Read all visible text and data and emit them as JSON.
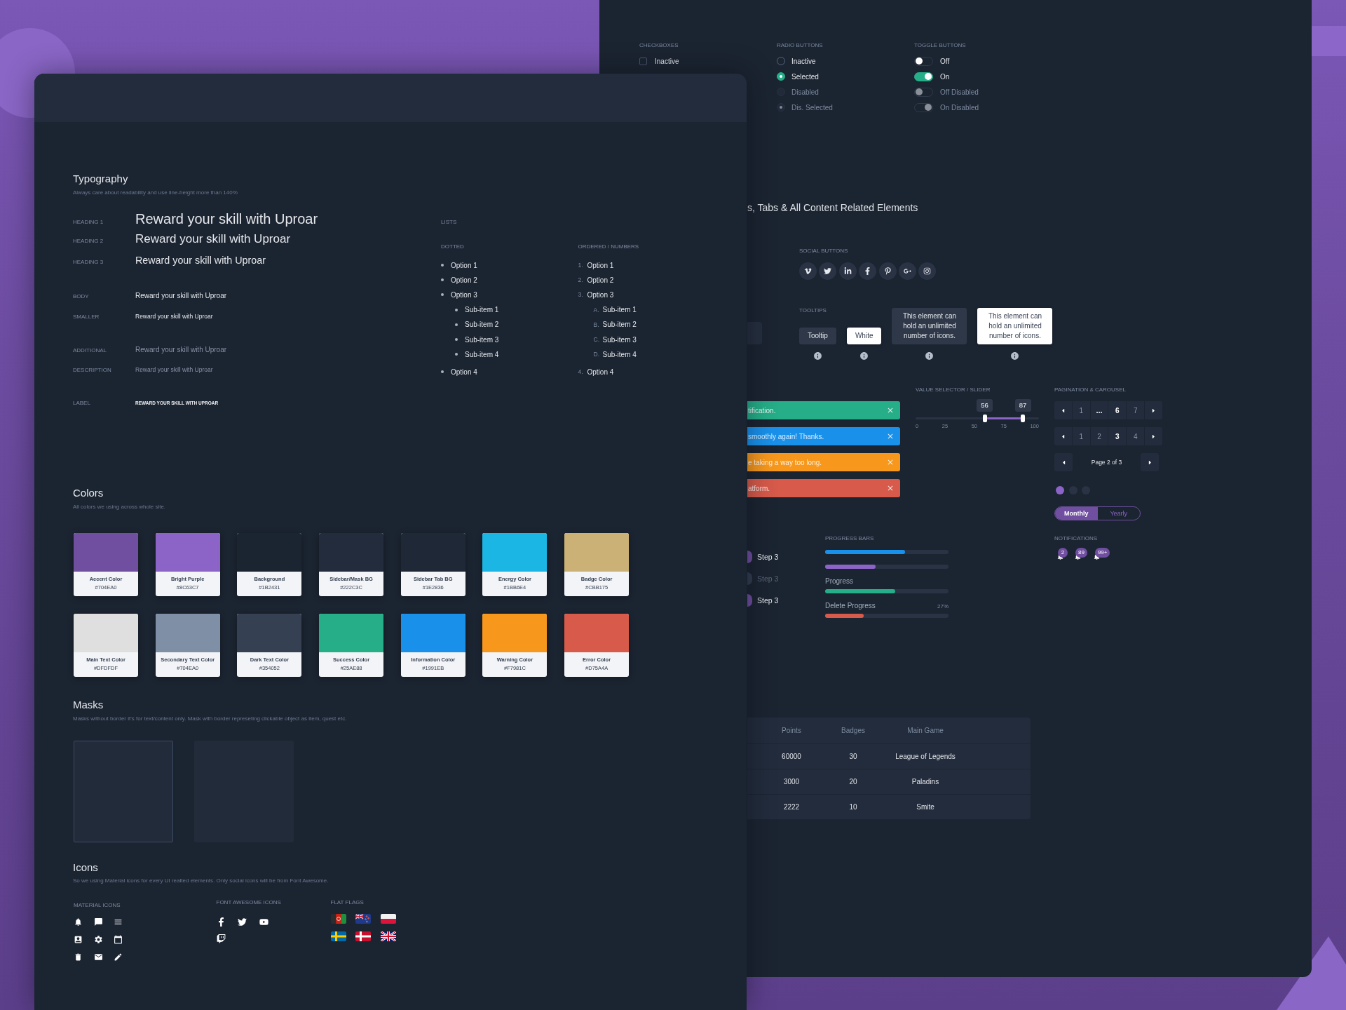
{
  "back_panel": {
    "checkboxes": {
      "label": "CHECKBOXES",
      "items": [
        {
          "label": "Inactive",
          "checked": false
        }
      ]
    },
    "radio_buttons": {
      "label": "RADIO BUTTONS",
      "items": [
        {
          "label": "Inactive",
          "selected": false,
          "disabled": false
        },
        {
          "label": "Selected",
          "selected": true,
          "disabled": false
        },
        {
          "label": "Disabled",
          "selected": false,
          "disabled": true
        },
        {
          "label": "Dis. Selected",
          "selected": true,
          "disabled": true
        }
      ]
    },
    "toggle_buttons": {
      "label": "TOGGLE BUTTONS",
      "items": [
        {
          "label": "Off",
          "on": false,
          "disabled": false
        },
        {
          "label": "On",
          "on": true,
          "disabled": false
        },
        {
          "label": "Off Disabled",
          "on": false,
          "disabled": true
        },
        {
          "label": "On Disabled",
          "on": true,
          "disabled": true
        }
      ]
    },
    "section_title": "s, Tabs & All Content Related Elements",
    "social_buttons": {
      "label": "SOCIAL BUTTONS"
    },
    "tooltips": {
      "label": "TOOLTIPS",
      "items": [
        {
          "kind": "dark",
          "text": "Tooltip"
        },
        {
          "kind": "white",
          "text": "White"
        },
        {
          "kind": "dark",
          "text": "This element can hold an unlimited number of icons."
        },
        {
          "kind": "white",
          "text": "This element can hold an unlimited number of icons."
        }
      ]
    },
    "alerts": [
      {
        "text": "tification.",
        "color": "#25ae88"
      },
      {
        "text": "smoothly again! Thanks.",
        "color": "#1991eb"
      },
      {
        "text": "e taking a way too long.",
        "color": "#f7981c"
      },
      {
        "text": "atform.",
        "color": "#d75a4a"
      }
    ],
    "slider": {
      "label": "VALUE SELECTOR / SLIDER",
      "handles": [
        {
          "level": 0.56,
          "reading": "56"
        },
        {
          "level": 0.87,
          "reading": "87"
        }
      ],
      "ticks": [
        "0",
        "25",
        "50",
        "75",
        "100"
      ]
    },
    "pagination": {
      "label": "PAGINATION & CAROUSEL",
      "pagers": [
        {
          "kind": "pages",
          "pages": [
            {
              "kind": "page",
              "text": "1",
              "selected": false
            },
            {
              "kind": "ellipsis",
              "text": "..."
            },
            {
              "kind": "page",
              "text": "6",
              "selected": true
            },
            {
              "kind": "page",
              "text": "7",
              "selected": false
            }
          ]
        },
        {
          "kind": "pages",
          "pages": [
            {
              "kind": "page",
              "text": "1",
              "selected": false
            },
            {
              "kind": "page",
              "text": "2",
              "selected": false
            },
            {
              "kind": "page",
              "text": "3",
              "selected": true
            },
            {
              "kind": "page",
              "text": "4",
              "selected": false
            }
          ]
        },
        {
          "kind": "summary",
          "text": "Page 2 of 3"
        }
      ],
      "carousel": [
        {
          "selected": true
        },
        {
          "selected": false
        },
        {
          "selected": false
        }
      ],
      "period_switch": [
        {
          "label": "Monthly",
          "selected": true
        },
        {
          "label": "Yearly",
          "selected": false
        }
      ]
    },
    "steps": [
      {
        "label": "Step 3",
        "active": true
      },
      {
        "label": "Step 3",
        "active": false
      },
      {
        "label": "Step 3",
        "active": true
      }
    ],
    "progress_bars": {
      "label": "PROGRESS BARS",
      "bars": [
        {
          "level": 0.65,
          "color": "#1991eb"
        },
        {
          "level": 0.41,
          "color": "#8c63c7"
        },
        {
          "label": "Progress",
          "level": 0.57,
          "color": "#25ae88"
        },
        {
          "label": "Delete Progress",
          "reading": "27%",
          "level": 0.31,
          "color": "#d75a4a"
        }
      ]
    },
    "notifications": {
      "label": "NOTIFICATIONS",
      "badges": [
        "2",
        "89",
        "99+"
      ]
    },
    "table": {
      "columns": [
        "Points",
        "Badges",
        "Main Game"
      ],
      "rows": [
        [
          "60000",
          "30",
          "League of Legends"
        ],
        [
          "3000",
          "20",
          "Paladins"
        ],
        [
          "2222",
          "10",
          "Smite"
        ]
      ]
    }
  },
  "front_panel": {
    "typography": {
      "title": "Typography",
      "subtitle": "Always care about readability and use line-height more than 140%",
      "styles": [
        {
          "kind": "h1",
          "label": "HEADING 1",
          "sample": "Reward your skill with Uproar"
        },
        {
          "kind": "h2",
          "label": "HEADING 2",
          "sample": "Reward your skill with Uproar"
        },
        {
          "kind": "h3",
          "label": "HEADING 3",
          "sample": "Reward your skill with Uproar"
        },
        {
          "kind": "body",
          "label": "BODY",
          "sample": "Reward your skill with Uproar"
        },
        {
          "kind": "smaller",
          "label": "SMALLER",
          "sample": "Reward your skill with Uproar"
        },
        {
          "kind": "additional",
          "label": "ADDITIONAL",
          "sample": "Reward your skill with Uproar"
        },
        {
          "kind": "description",
          "label": "DESCRIPTION",
          "sample": "Reward your skill with Uproar"
        },
        {
          "kind": "label",
          "label": "LABEL",
          "sample": "REWARD YOUR SKILL WITH UPROAR"
        }
      ]
    },
    "lists": {
      "label": "LISTS",
      "dotted": {
        "label": "DOTTED",
        "items": [
          {
            "text": "Option 1"
          },
          {
            "text": "Option 2"
          },
          {
            "text": "Option 3",
            "children": [
              {
                "text": "Sub-item 1"
              },
              {
                "text": "Sub-item 2"
              },
              {
                "text": "Sub-item 3"
              },
              {
                "text": "Sub-item 4"
              }
            ]
          },
          {
            "text": "Option 4"
          }
        ]
      },
      "ordered": {
        "label": "ORDERED / NUMBERS",
        "items": [
          {
            "marker": "1.",
            "text": "Option 1"
          },
          {
            "marker": "2.",
            "text": "Option 2"
          },
          {
            "marker": "3.",
            "text": "Option 3",
            "children": [
              {
                "marker": "A.",
                "text": "Sub-item 1"
              },
              {
                "marker": "B.",
                "text": "Sub-item 2"
              },
              {
                "marker": "C.",
                "text": "Sub-item 3"
              },
              {
                "marker": "D.",
                "text": "Sub-item 4"
              }
            ]
          },
          {
            "marker": "4.",
            "text": "Option 4"
          }
        ]
      }
    },
    "colors": {
      "title": "Colors",
      "subtitle": "All colors we using across whole site.",
      "swatches": [
        {
          "name": "Accent Color",
          "hex": "#704EA0",
          "color": "#704ea0"
        },
        {
          "name": "Bright Purple",
          "hex": "#8C63C7",
          "color": "#8c63c7"
        },
        {
          "name": "Background",
          "hex": "#1B2431",
          "color": "#1b2431"
        },
        {
          "name": "Sidebar/Mask BG",
          "hex": "#222C3C",
          "color": "#222c3c"
        },
        {
          "name": "Sidebar Tab BG",
          "hex": "#1E2836",
          "color": "#1e2836"
        },
        {
          "name": "Energy Color",
          "hex": "#1BB6E4",
          "color": "#1bb6e4"
        },
        {
          "name": "Badge Color",
          "hex": "#CBB175",
          "color": "#cbb175"
        },
        {
          "name": "Main Text Color",
          "hex": "#DFDFDF",
          "color": "#dfdfdf"
        },
        {
          "name": "Secondary Text Color",
          "hex": "#704EA0",
          "color": "#7f8fa6"
        },
        {
          "name": "Dark Text Color",
          "hex": "#354052",
          "color": "#354052"
        },
        {
          "name": "Success Color",
          "hex": "#25AE88",
          "color": "#25ae88"
        },
        {
          "name": "Information Color",
          "hex": "#1991EB",
          "color": "#1991eb"
        },
        {
          "name": "Warning Color",
          "hex": "#F7981C",
          "color": "#f7981c"
        },
        {
          "name": "Error Color",
          "hex": "#D75A4A",
          "color": "#d75a4a"
        }
      ]
    },
    "masks": {
      "title": "Masks",
      "subtitle": "Masks without border it's for text/content only. Mask with border represeting clickable object as item, quest etc.",
      "items": [
        {
          "bordered": true
        },
        {
          "bordered": false
        }
      ]
    },
    "icons": {
      "title": "Icons",
      "subtitle": "So we using Material icons for every UI realted elements. Only social icons will be from Font Awesome.",
      "material_label": "MATERIAL ICONS",
      "font_awesome_label": "FONT AWESOME ICONS",
      "flags_label": "FLAT FLAGS"
    }
  }
}
